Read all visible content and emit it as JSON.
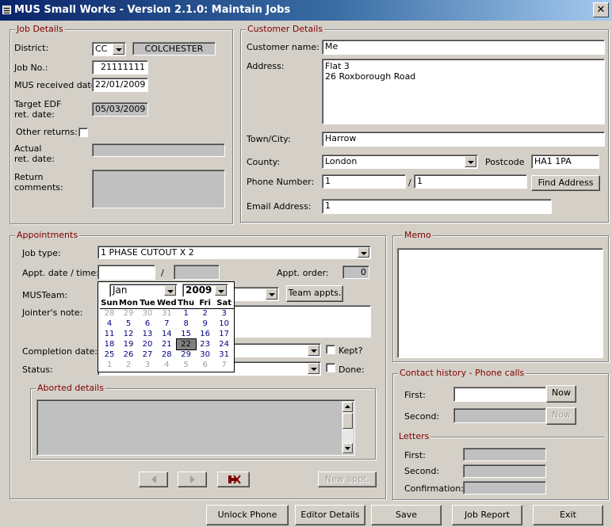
{
  "window": {
    "title": "MUS Small Works - Version 2.1.0: Maintain Jobs",
    "close_glyph": "✕"
  },
  "job_details": {
    "title": "Job Details",
    "district_label": "District:",
    "district_code": "CC",
    "district_name": "COLCHESTER",
    "job_no_label": "Job No.:",
    "job_no": "21111111",
    "mus_received_label": "MUS received date:",
    "mus_received": "22/01/2009",
    "target_edf_label": "Target EDF\nret. date:",
    "target_edf": "05/03/2009",
    "other_returns_label": "Other returns:",
    "actual_ret_label": "Actual\nret. date:",
    "actual_ret": "",
    "return_comments_label": "Return\ncomments:",
    "return_comments": ""
  },
  "customer_details": {
    "title": "Customer Details",
    "name_label": "Customer name:",
    "name": "Me",
    "address_label": "Address:",
    "address": "Flat 3\n26 Roxborough Road",
    "town_label": "Town/City:",
    "town": "Harrow",
    "county_label": "County:",
    "county": "London",
    "postcode_label": "Postcode",
    "postcode": "HA1 1PA",
    "phone_label": "Phone Number:",
    "phone_area": "1",
    "phone_sep": "/",
    "phone_number": "1",
    "find_address": "Find Address",
    "email_label": "Email Address:",
    "email": "1"
  },
  "appointments": {
    "title": "Appointments",
    "job_type_label": "Job type:",
    "job_type": "1 PHASE CUTOUT X 2",
    "appt_date_label": "Appt. date / time:",
    "appt_date": "",
    "appt_sep": "/",
    "appt_time": "",
    "appt_order_label": "Appt. order:",
    "appt_order": "0",
    "musteam_label": "MUSTeam:",
    "team_appts": "Team appts.",
    "jointer_note_label": "Jointer's note:",
    "completion_label": "Completion date:",
    "kept_label": "Kept?",
    "status_label": "Status:",
    "done_label": "Done:",
    "aborted_title": "Aborted details",
    "new_appt": "New appt.",
    "prev_icon": "triangle-left",
    "next_icon": "triangle-right",
    "delete_icon": "delete-record"
  },
  "calendar": {
    "month": "Jan",
    "year": "2009",
    "days": [
      "Sun",
      "Mon",
      "Tue",
      "Wed",
      "Thu",
      "Fri",
      "Sat"
    ],
    "weeks": [
      [
        [
          "28",
          1
        ],
        [
          "29",
          1
        ],
        [
          "30",
          1
        ],
        [
          "31",
          1
        ],
        [
          "1",
          0
        ],
        [
          "2",
          0
        ],
        [
          "3",
          0
        ]
      ],
      [
        [
          "4",
          0
        ],
        [
          "5",
          0
        ],
        [
          "6",
          0
        ],
        [
          "7",
          0
        ],
        [
          "8",
          0
        ],
        [
          "9",
          0
        ],
        [
          "10",
          0
        ]
      ],
      [
        [
          "11",
          0
        ],
        [
          "12",
          0
        ],
        [
          "13",
          0
        ],
        [
          "14",
          0
        ],
        [
          "15",
          0
        ],
        [
          "16",
          0
        ],
        [
          "17",
          0
        ]
      ],
      [
        [
          "18",
          0
        ],
        [
          "19",
          0
        ],
        [
          "20",
          0
        ],
        [
          "21",
          0
        ],
        [
          "22",
          2
        ],
        [
          "23",
          0
        ],
        [
          "24",
          0
        ]
      ],
      [
        [
          "25",
          0
        ],
        [
          "26",
          0
        ],
        [
          "27",
          0
        ],
        [
          "28",
          0
        ],
        [
          "29",
          0
        ],
        [
          "30",
          0
        ],
        [
          "31",
          0
        ]
      ],
      [
        [
          "1",
          1
        ],
        [
          "2",
          1
        ],
        [
          "3",
          1
        ],
        [
          "4",
          1
        ],
        [
          "5",
          1
        ],
        [
          "6",
          1
        ],
        [
          "7",
          1
        ]
      ]
    ]
  },
  "memo": {
    "title": "Memo",
    "text": ""
  },
  "contact_history": {
    "title": "Contact history - Phone calls",
    "first_label": "First:",
    "second_label": "Second:",
    "now_label": "Now"
  },
  "letters": {
    "title": "Letters",
    "first_label": "First:",
    "second_label": "Second:",
    "confirmation_label": "Confirmation:"
  },
  "footer": {
    "unlock": "Unlock Phone Calls",
    "editor": "Editor Details",
    "save": "Save",
    "job_report": "Job Report",
    "exit": "Exit"
  }
}
